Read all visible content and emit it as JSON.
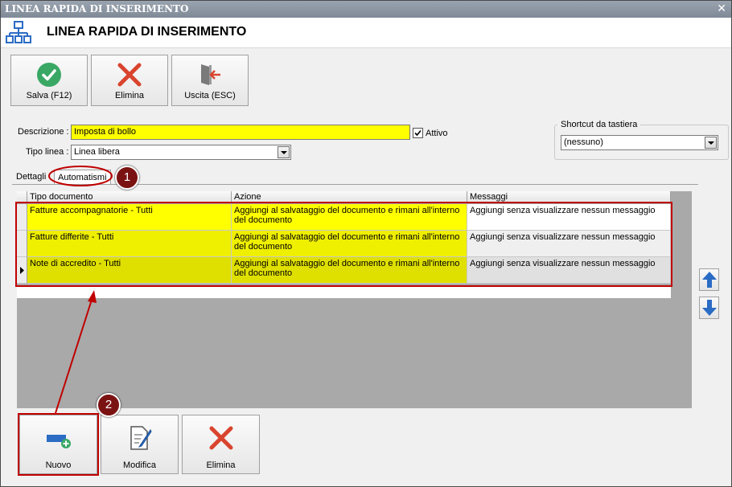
{
  "window": {
    "titlebar_text": "LINEA RAPIDA DI INSERIMENTO",
    "close_glyph": "✕"
  },
  "header": {
    "title": "LINEA RAPIDA DI INSERIMENTO",
    "icon": "org-chart-icon"
  },
  "toolbar": {
    "save_label": "Salva (F12)",
    "delete_label": "Elimina",
    "exit_label": "Uscita (ESC)"
  },
  "form": {
    "descrizione_label": "Descrizione :",
    "descrizione_value": "Imposta di bollo",
    "attivo_label": "Attivo",
    "attivo_checked": true,
    "tipo_linea_label": "Tipo linea :",
    "tipo_linea_value": "Linea libera"
  },
  "shortcut": {
    "group_title": "Shortcut da tastiera",
    "value": "(nessuno)"
  },
  "tabs": [
    {
      "label": "Dettagli",
      "active": false
    },
    {
      "label": "Automatismi",
      "active": true
    }
  ],
  "grid": {
    "columns": [
      "Tipo documento",
      "Azione",
      "Messaggi"
    ],
    "rows": [
      {
        "tipo": "Fatture accompagnatorie - Tutti",
        "azione": "Aggiungi al salvataggio del documento e rimani all'interno del documento",
        "messaggi": "Aggiungi senza visualizzare nessun messaggio"
      },
      {
        "tipo": "Fatture differite - Tutti",
        "azione": "Aggiungi al salvataggio del documento e rimani all'interno del documento",
        "messaggi": "Aggiungi senza visualizzare nessun messaggio"
      },
      {
        "tipo": "Note di accredito - Tutti",
        "azione": "Aggiungi al salvataggio del documento e rimani all'interno del documento",
        "messaggi": "Aggiungi senza visualizzare nessun messaggio"
      }
    ]
  },
  "bottom_buttons": {
    "new_label": "Nuovo",
    "edit_label": "Modifica",
    "delete_label": "Elimina"
  },
  "annotations": {
    "badge1": "1",
    "badge2": "2"
  },
  "colors": {
    "highlight": "#ffff00",
    "annotation_red": "#c00000",
    "check_green": "#3aa865",
    "delete_red": "#d9442e",
    "arrow_blue": "#2b6cc4"
  }
}
